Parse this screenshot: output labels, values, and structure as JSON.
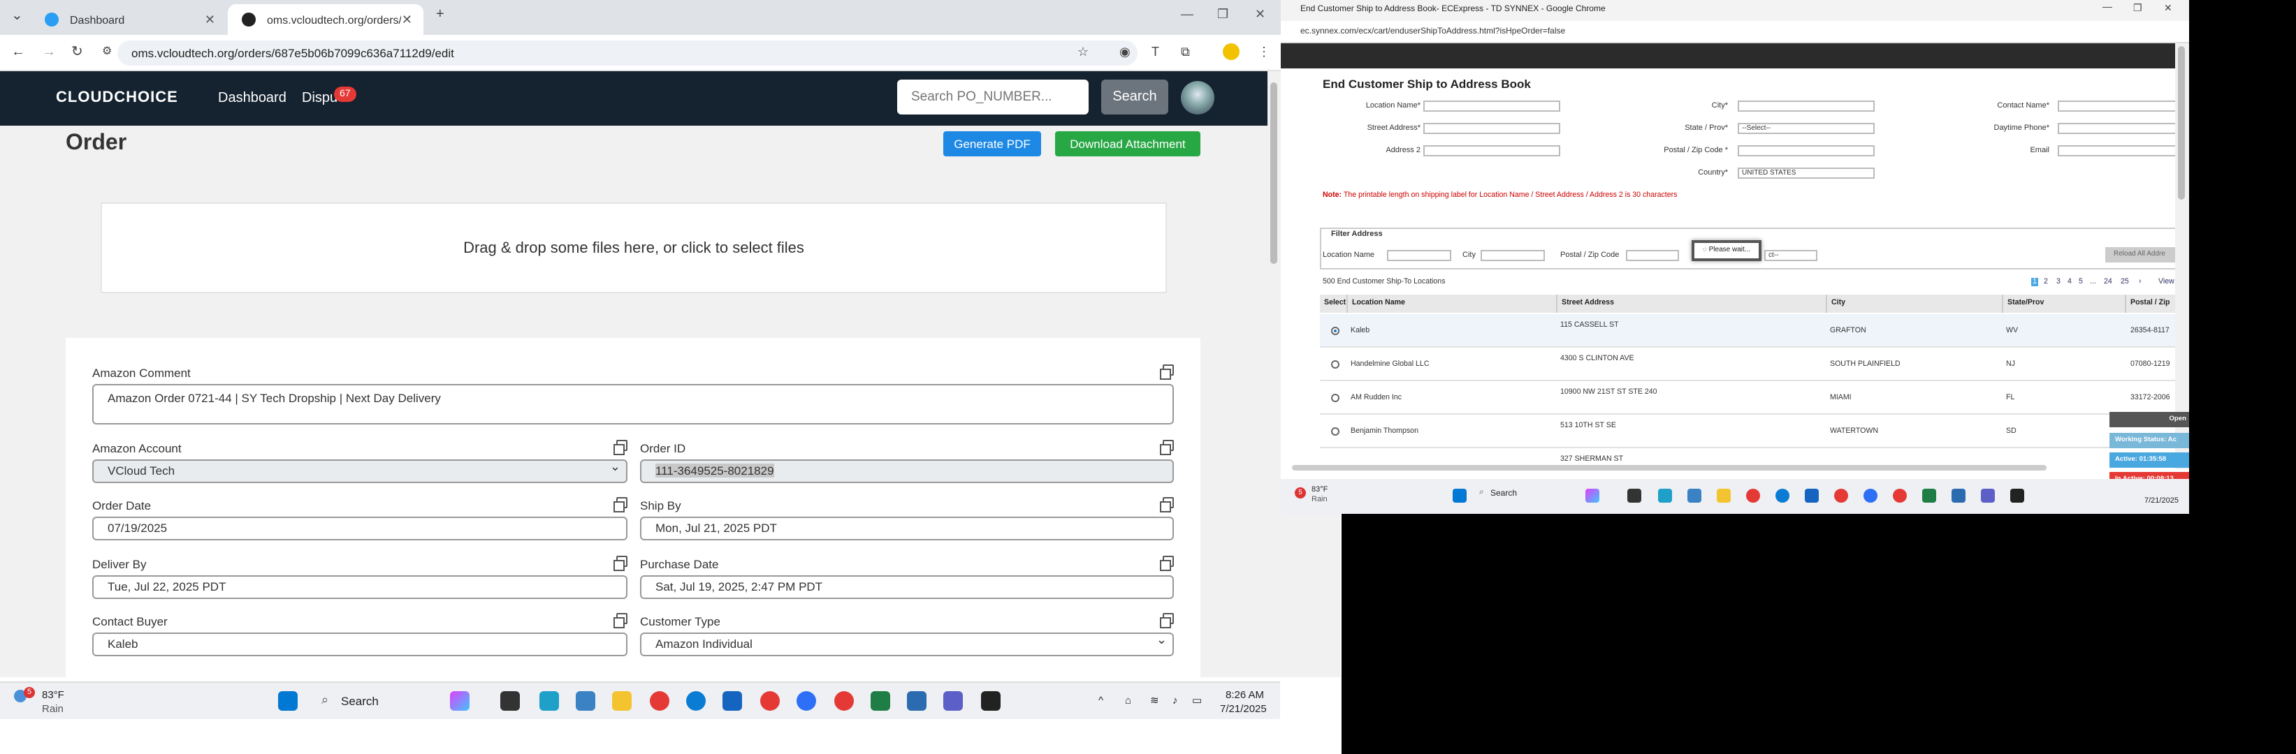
{
  "left_browser": {
    "tabs": [
      {
        "label": "Dashboard"
      },
      {
        "label": "oms.vcloudtech.org/orders/687"
      }
    ],
    "url": "oms.vcloudtech.org/orders/687e5b06b7099c636a7112d9/edit"
  },
  "app": {
    "logo": "CLOUDCHOICE",
    "nav": {
      "dashboard": "Dashboard",
      "disputes": "Dispu",
      "disputes_count": "67"
    },
    "search": {
      "placeholder": "Search PO_NUMBER...",
      "button": "Search"
    },
    "page_title": "Order",
    "buttons": {
      "pdf": "Generate PDF",
      "download": "Download Attachment"
    },
    "dropzone": "Drag & drop some files here, or click to select files",
    "form": {
      "amazon_comment_label": "Amazon Comment",
      "amazon_comment": "Amazon Order 0721-44 | SY Tech Dropship | Next Day Delivery",
      "amazon_account_label": "Amazon Account",
      "amazon_account": "VCloud Tech",
      "order_id_label": "Order ID",
      "order_id": "111-3649525-8021829",
      "order_date_label": "Order Date",
      "order_date": "07/19/2025",
      "ship_by_label": "Ship By",
      "ship_by": "Mon, Jul 21, 2025 PDT",
      "deliver_by_label": "Deliver By",
      "deliver_by": "Tue, Jul 22, 2025 PDT",
      "purchase_date_label": "Purchase Date",
      "purchase_date": "Sat, Jul 19, 2025, 2:47 PM PDT",
      "contact_buyer_label": "Contact Buyer",
      "contact_buyer": "Kaleb",
      "customer_type_label": "Customer Type",
      "customer_type": "Amazon Individual"
    }
  },
  "left_taskbar": {
    "weather_temp": "83°F",
    "weather_text": "Rain",
    "weather_badge": "5",
    "search": "Search",
    "time": "8:26 AM",
    "date": "7/21/2025"
  },
  "right_browser": {
    "title": "End Customer Ship to Address Book- ECExpress - TD SYNNEX - Google Chrome",
    "url": "ec.synnex.com/ecx/cart/enduserShipToAddress.html?isHpeOrder=false",
    "heading": "End Customer Ship to Address Book",
    "labels": {
      "location_name": "Location Name*",
      "street_address": "Street Address*",
      "address2": "Address 2",
      "city": "City*",
      "state": "State / Prov*",
      "postal": "Postal / Zip Code *",
      "country": "Country*",
      "contact_name": "Contact Name*",
      "daytime_phone": "Daytime Phone*",
      "email": "Email"
    },
    "state_value": "--Select--",
    "country_value": "UNITED STATES",
    "note_label": "Note:",
    "note": "The printable length on shipping label for Location Name / Street Address / Address 2 is 30 characters",
    "filter_title": "Filter Address",
    "filter_labels": {
      "location": "Location Name",
      "city": "City",
      "postal": "Postal / Zip Code"
    },
    "filter_select": "ct--",
    "please_wait": "Please wait...",
    "reload": "Reload All Addre",
    "count": "500 End Customer Ship-To Locations",
    "pager": [
      "1",
      "2",
      "3",
      "4",
      "5",
      "...",
      "24",
      "25",
      "›",
      "View"
    ],
    "columns": [
      "Select",
      "Location Name",
      "Street Address",
      "City",
      "State/Prov",
      "Postal / Zip"
    ],
    "rows": [
      {
        "name": "Kaleb",
        "street": "115 CASSELL ST",
        "city": "GRAFTON",
        "state": "WV",
        "postal": "26354-8117"
      },
      {
        "name": "Handelmine Global LLC",
        "street": "4300 S CLINTON AVE",
        "city": "SOUTH PLAINFIELD",
        "state": "NJ",
        "postal": "07080-1219"
      },
      {
        "name": "AM Rudden Inc",
        "street": "10900 NW 21ST ST STE 240",
        "city": "MIAMI",
        "state": "FL",
        "postal": "33172-2006"
      },
      {
        "name": "Benjamin Thompson",
        "street": "513 10TH ST SE",
        "city": "WATERTOWN",
        "state": "SD",
        "postal": ""
      },
      {
        "name": "",
        "street": "327 SHERMAN ST",
        "city": "",
        "state": "",
        "postal": ""
      }
    ],
    "status": {
      "open": "Open",
      "working": "Working Status: Ac",
      "active": "Active: 01:35:58",
      "inactive": "In Active: 00:08:13"
    }
  },
  "right_taskbar": {
    "weather_temp": "83°F",
    "weather_text": "Rain",
    "weather_badge": "5",
    "search": "Search",
    "date": "7/21/2025"
  }
}
